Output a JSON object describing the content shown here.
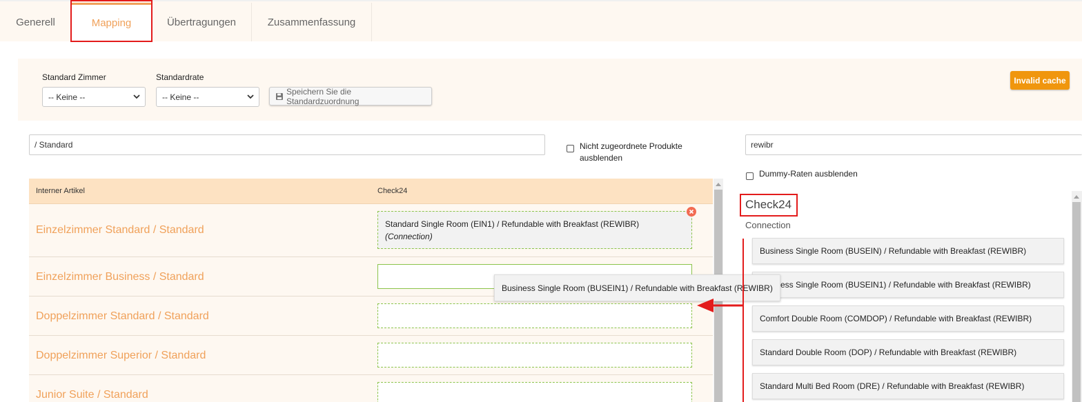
{
  "tabs": [
    {
      "label": "Generell",
      "active": false
    },
    {
      "label": "Mapping",
      "active": true
    },
    {
      "label": "Übertragungen",
      "active": false
    },
    {
      "label": "Zusammenfassung",
      "active": false
    }
  ],
  "filters": {
    "standard_room_label": "Standard Zimmer",
    "standard_room_value": "-- Keine --",
    "standard_rate_label": "Standardrate",
    "standard_rate_value": "-- Keine --",
    "save_label": "Speichern Sie die Standardzuordnung",
    "invalid_cache_label": "Invalid cache"
  },
  "left_search": {
    "value": "/ Standard"
  },
  "hide_unassigned": {
    "label_line1": "Nicht zugeordnete Produkte",
    "label_line2": "ausblenden",
    "checked": false
  },
  "right_search": {
    "value": "rewibr"
  },
  "hide_dummy": {
    "label": "Dummy-Raten ausblenden",
    "checked": false
  },
  "table": {
    "headers": [
      "Interner Artikel",
      "Check24"
    ],
    "rows": [
      {
        "label": "Einzelzimmer Standard / Standard",
        "mapped": "Standard Single Room (EIN1) / Refundable with Breakfast (REWIBR)",
        "mapped_sub": "(Connection)"
      },
      {
        "label": "Einzelzimmer Business / Standard",
        "mapped": ""
      },
      {
        "label": "Doppelzimmer Standard / Standard",
        "mapped": ""
      },
      {
        "label": "Doppelzimmer Superior / Standard",
        "mapped": ""
      },
      {
        "label": "Junior Suite / Standard",
        "mapped": ""
      }
    ]
  },
  "channel": {
    "title": "Check24",
    "subtitle": "Connection",
    "items": [
      "Business Single Room (BUSEIN) / Refundable with Breakfast (REWIBR)",
      "Business Single Room (BUSEIN1) / Refundable with Breakfast (REWIBR)",
      "Comfort Double Room (COMDOP) / Refundable with Breakfast (REWIBR)",
      "Standard Double Room (DOP) / Refundable with Breakfast (REWIBR)",
      "Standard Multi Bed Room (DRE) / Refundable with Breakfast (REWIBR)"
    ],
    "item2_visible_part": "ess Single Room (BUSEIN1) / Refundable with Breakfast (REWIBR)"
  },
  "dragging_item": {
    "label": "Business Single Room (BUSEIN1) / Refundable with Breakfast (REWIBR)"
  },
  "colors": {
    "accent": "#f0a15a",
    "annotation": "#e31b1b",
    "invalid_cache": "#f0960e",
    "drop_border": "#8bc34a"
  }
}
